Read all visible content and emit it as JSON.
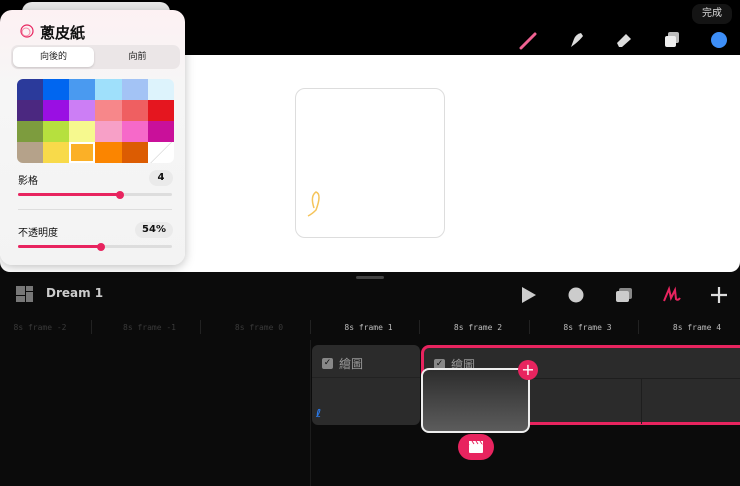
{
  "topbar": {
    "done_label": "完成",
    "tools": [
      "brush-icon",
      "smudge-icon",
      "eraser-icon",
      "layers-icon",
      "color-icon"
    ],
    "current_color": "#3d8ef7"
  },
  "onion": {
    "title": "蔥皮紙",
    "tabs": [
      "向後的",
      "向前"
    ],
    "active_tab": 0,
    "palette": [
      "#2b3a9b",
      "#0066f0",
      "#4a9af0",
      "#9fe0fb",
      "#a3c3f5",
      "#ddf3fc",
      "#4b2880",
      "#9a0fe3",
      "#cc7ef5",
      "#f7878a",
      "#ef5f61",
      "#e5161f",
      "#7d9c3e",
      "#b6e03e",
      "#f6f98e",
      "#f7a0c7",
      "#f669c9",
      "#c9109a",
      "#b5a28a",
      "#f8da4a",
      "#fbb027",
      "#fb8500",
      "#dc5c02",
      "#ffffff"
    ],
    "selected_swatch": 20,
    "frames_label": "影格",
    "frames_value": "4",
    "frames_fraction": 0.66,
    "opacity_label": "不透明度",
    "opacity_value": "54%",
    "opacity_fraction": 0.54
  },
  "timeline": {
    "project_name": "Dream 1",
    "frame_labels": [
      "8s frame -2",
      "8s frame -1",
      "8s frame 0",
      "8s frame 1",
      "8s frame 2",
      "8s frame 3",
      "8s frame 4"
    ],
    "tracks": [
      "繪圖",
      "繪圖"
    ]
  },
  "accent": "#e8245f"
}
